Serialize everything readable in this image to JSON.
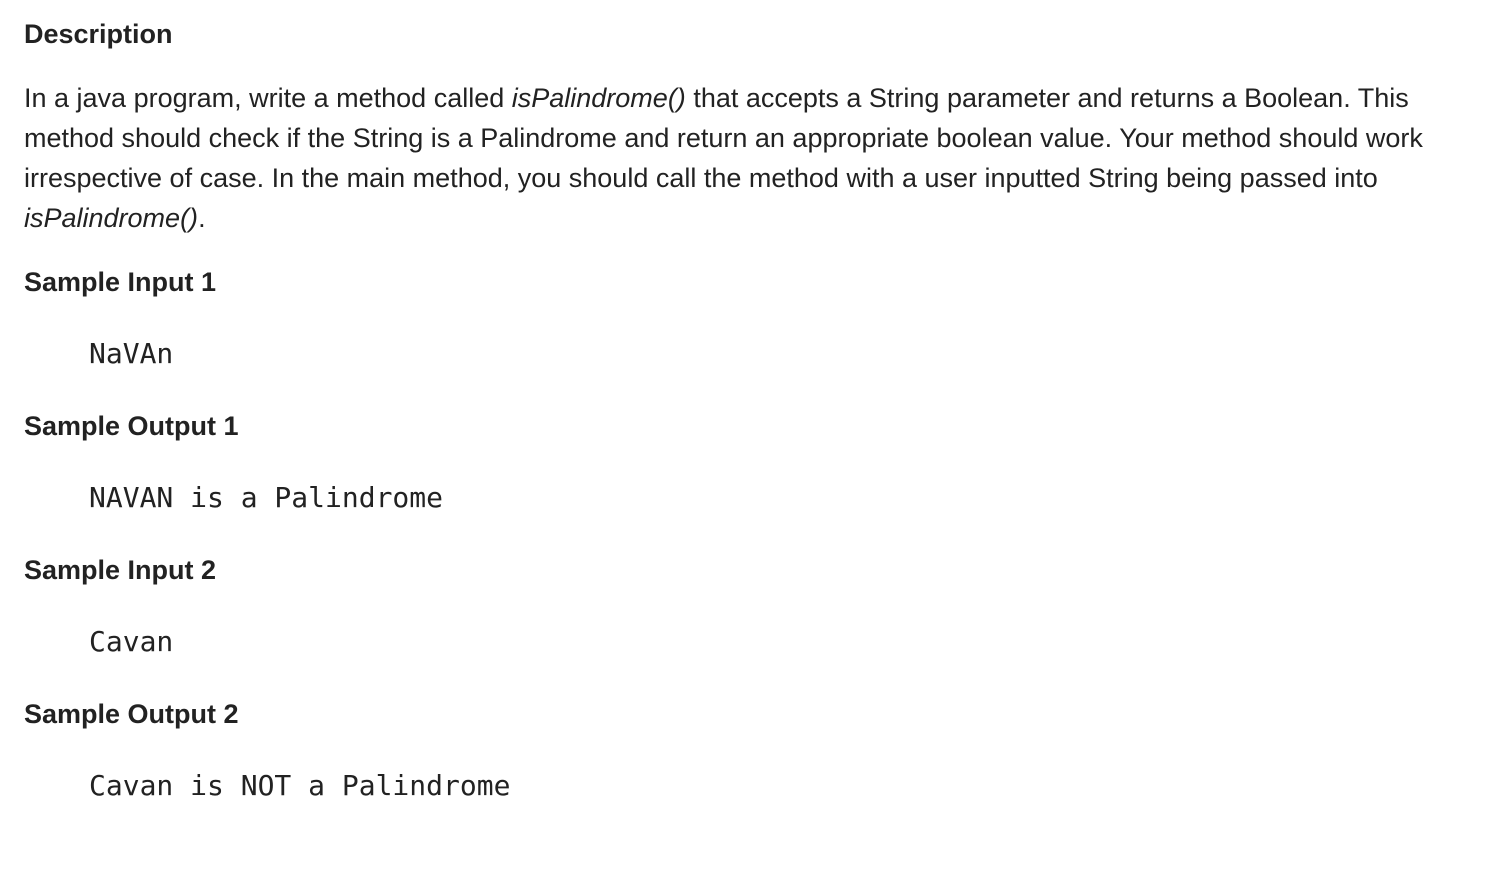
{
  "heading": "Description",
  "paragraph": {
    "part1": "In a java program, write a method called ",
    "method1": "isPalindrome()",
    "part2": " that accepts a String parameter and returns a Boolean. This method should check if the String is a Palindrome and return an appropriate boolean value. Your method should work irrespective of case. In the main method, you should call the method with a user inputted String being passed into ",
    "method2": "isPalindrome()",
    "part3": "."
  },
  "samples": [
    {
      "label": "Sample Input 1",
      "value": "NaVAn"
    },
    {
      "label": "Sample Output 1",
      "value": "NAVAN is a Palindrome"
    },
    {
      "label": "Sample Input 2",
      "value": "Cavan"
    },
    {
      "label": "Sample Output 2",
      "value": "Cavan is NOT a Palindrome"
    }
  ]
}
